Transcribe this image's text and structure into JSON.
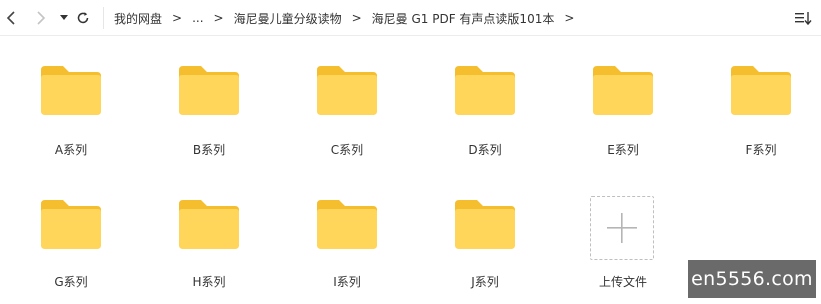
{
  "toolbar": {
    "back_icon": "chevron-left-icon",
    "forward_icon": "chevron-right-icon",
    "history_icon": "caret-down-icon",
    "refresh_icon": "refresh-icon",
    "sort_icon": "sort-icon"
  },
  "breadcrumb": {
    "items": [
      "我的网盘",
      "...",
      "海尼曼儿童分级读物",
      "海尼曼 G1 PDF 有声点读版101本"
    ],
    "separator": ">"
  },
  "folders": [
    {
      "label": "A系列"
    },
    {
      "label": "B系列"
    },
    {
      "label": "C系列"
    },
    {
      "label": "D系列"
    },
    {
      "label": "E系列"
    },
    {
      "label": "F系列"
    },
    {
      "label": "G系列"
    },
    {
      "label": "H系列"
    },
    {
      "label": "I系列"
    },
    {
      "label": "J系列"
    }
  ],
  "upload": {
    "label": "上传文件",
    "icon": "plus-icon"
  },
  "watermark": {
    "text": "en5556.com"
  },
  "colors": {
    "folder_front": "#FFD659",
    "folder_back": "#F5BE2E",
    "accent_border": "#bfbfbf"
  }
}
